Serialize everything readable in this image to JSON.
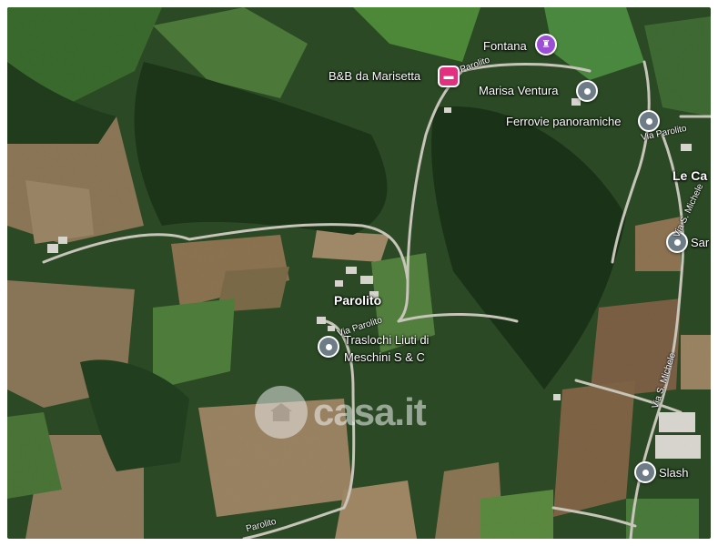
{
  "places": {
    "fontana": "Fontana",
    "bnb": "B&B da Marisetta",
    "marisa": "Marisa Ventura",
    "ferrovie": "Ferrovie panoramiche",
    "le_ca": "Le Ca",
    "san": "Sar",
    "parolito": "Parolito",
    "traslochi_1": "Traslochi Liuti di",
    "traslochi_2": "Meschini S & C",
    "slash": "Slash"
  },
  "roads": {
    "parolito_top": "Parolito",
    "parolito_right": "Via Parolito",
    "via_s_michele_top": "Via S. Michele",
    "via_parolito_mid": "Via Parolito",
    "via_s_michele_bottom": "Via S. Michele",
    "parolito_bottom": "Parolito"
  },
  "watermark": "casa.it",
  "icons": {
    "gray_pin": "location-pin-icon",
    "hotel_pin": "bed-icon",
    "fountain_pin": "fountain-icon"
  },
  "colors": {
    "forest": "#1f3a1c",
    "field_green": "#3d6a2e",
    "field_brown": "#8a7a58",
    "road": "#c9c6bb",
    "hotel": "#e0307e",
    "attraction": "#9c4fd6",
    "pin_gray": "#6e7c87"
  }
}
